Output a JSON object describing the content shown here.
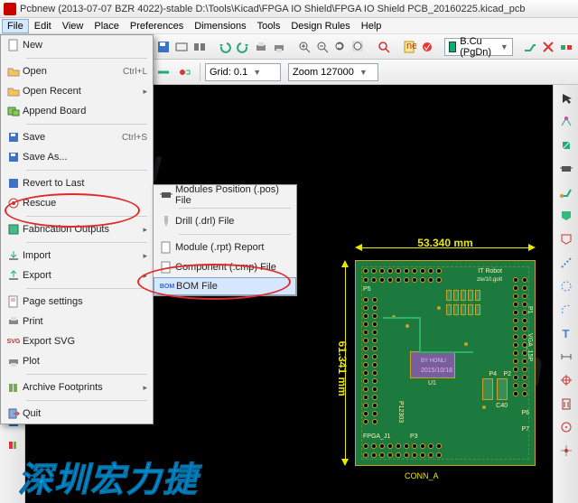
{
  "title": "Pcbnew (2013-07-07 BZR 4022)-stable D:\\Tools\\Kicad\\FPGA IO Shield\\FPGA IO Shield PCB_20160225.kicad_pcb",
  "menubar": [
    "File",
    "Edit",
    "View",
    "Place",
    "Preferences",
    "Dimensions",
    "Tools",
    "Design Rules",
    "Help"
  ],
  "toolbar": {
    "layer_label": "B.Cu (PgDn)",
    "grid_label": "Grid: 0.1",
    "zoom_label": "Zoom 127000"
  },
  "file_menu": {
    "new": "New",
    "open": "Open",
    "open_acc": "Ctrl+L",
    "open_recent": "Open Recent",
    "append": "Append Board",
    "save": "Save",
    "save_acc": "Ctrl+S",
    "save_as": "Save As...",
    "revert": "Revert to Last",
    "rescue": "Rescue",
    "fab": "Fabrication Outputs",
    "import": "Import",
    "export": "Export",
    "page": "Page settings",
    "print": "Print",
    "svg": "Export SVG",
    "plot": "Plot",
    "archive": "Archive Footprints",
    "quit": "Quit"
  },
  "fab_submenu": {
    "modules": "Modules Position (.pos) File",
    "drill": "Drill (.drl) File",
    "module_rpt": "Module (.rpt) Report",
    "cmp": "Component (.cmp) File",
    "bom": "BOM File"
  },
  "dims": {
    "width": "53.340  mm",
    "height": "61.341  mm"
  },
  "silks": {
    "p5": "P5",
    "p4": "P4",
    "p2": "P2",
    "p1": "P1",
    "p3": "P3",
    "vga": "VGA_15P",
    "fpga": "FPGA_J1",
    "conn": "CONN_A",
    "u1": "U1",
    "c40": "C40",
    "p12303": "P12303",
    "board": "IT Robot",
    "board2": "zte/10.goIt",
    "date": "2015/10/18",
    "by": "BY HONLI",
    "p6": "P6",
    "p7": "P7"
  },
  "brand": "深圳宏力捷",
  "watermarks": {
    "w1": "www",
    "w2": ".a",
    "w3": "com"
  }
}
